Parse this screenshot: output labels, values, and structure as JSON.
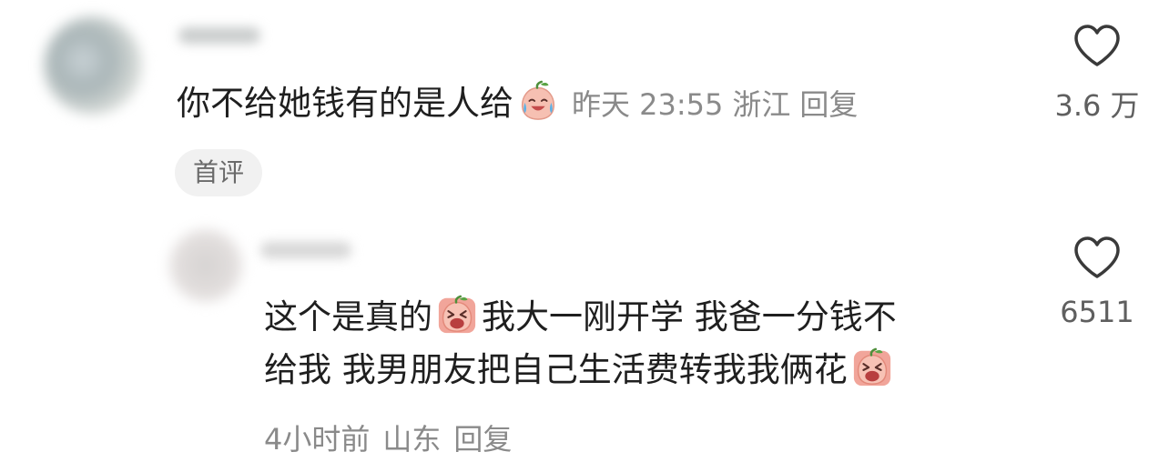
{
  "comment": {
    "text": "你不给她钱有的是人给",
    "time": "昨天 23:55",
    "location": "浙江",
    "reply_label": "回复",
    "tag": "首评",
    "like_count": "3.6 万",
    "emoji": "crying-peach-emoji"
  },
  "reply": {
    "line1_part1": "这个是真的",
    "line1_part2": "我大一刚开学 我爸一分钱不",
    "line2": "给我 我男朋友把自己生活费转我我俩花",
    "time": "4小时前",
    "location": "山东",
    "reply_label": "回复",
    "like_count": "6511",
    "emoji": "sobbing-peach-emoji"
  },
  "colors": {
    "text": "#1f1f1f",
    "meta": "#8a8a8a",
    "tag_bg": "#f1f1f1",
    "emoji_peach": "#f3b6a8"
  }
}
